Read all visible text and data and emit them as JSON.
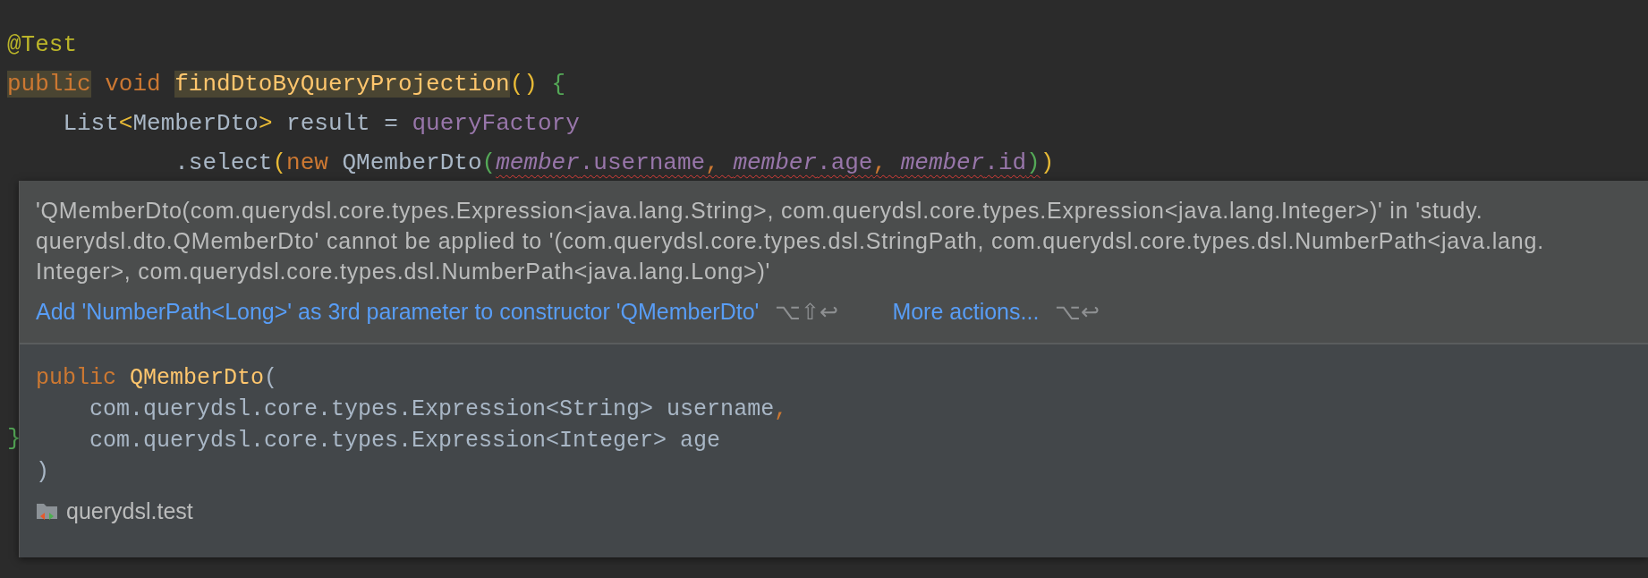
{
  "editor": {
    "lines": [
      [
        {
          "text": "@Test",
          "kind": "annotation"
        }
      ],
      [
        {
          "text": "public",
          "kind": "keyword",
          "highlight": true
        },
        {
          "text": " void ",
          "kind": "keyword"
        },
        {
          "text": "findDtoByQueryProjection",
          "kind": "method",
          "highlight": true
        },
        {
          "text": "()",
          "kind": "paren"
        },
        {
          "text": " {",
          "kind": "nested"
        }
      ],
      [
        {
          "text": "    List",
          "kind": "text"
        },
        {
          "text": "<",
          "kind": "paren"
        },
        {
          "text": "MemberDto",
          "kind": "text"
        },
        {
          "text": ">",
          "kind": "paren"
        },
        {
          "text": " result = ",
          "kind": "text"
        },
        {
          "text": "queryFactory",
          "kind": "field"
        }
      ],
      [
        {
          "text": "            .select",
          "kind": "text"
        },
        {
          "text": "(",
          "kind": "paren"
        },
        {
          "text": "new",
          "kind": "keyword"
        },
        {
          "text": " QMemberDto",
          "kind": "text"
        },
        {
          "text": "(",
          "kind": "nested"
        },
        {
          "text": "member",
          "kind": "static",
          "error": true
        },
        {
          "text": ".username",
          "kind": "field",
          "error": true
        },
        {
          "text": ", ",
          "kind": "comma",
          "error": true
        },
        {
          "text": "member",
          "kind": "static",
          "error": true
        },
        {
          "text": ".age",
          "kind": "field",
          "error": true
        },
        {
          "text": ", ",
          "kind": "comma",
          "error": true
        },
        {
          "text": "member",
          "kind": "static",
          "error": true
        },
        {
          "text": ".id",
          "kind": "field",
          "error": true
        },
        {
          "text": ")",
          "kind": "nested",
          "error": true
        },
        {
          "text": ")",
          "kind": "paren"
        }
      ]
    ],
    "closing": [
      {
        "text": "}",
        "kind": "nested"
      }
    ]
  },
  "popup": {
    "message_lines": [
      "'QMemberDto(com.querydsl.core.types.Expression<java.lang.String>, com.querydsl.core.types.Expression<java.lang.Integer>)' in 'study.",
      "querydsl.dto.QMemberDto' cannot be applied to '(com.querydsl.core.types.dsl.StringPath, com.querydsl.core.types.dsl.NumberPath<java.lang.",
      "Integer>, com.querydsl.core.types.dsl.NumberPath<java.lang.Long>)'"
    ],
    "actions": [
      {
        "label": "Add 'NumberPath<Long>' as 3rd parameter to constructor 'QMemberDto'",
        "shortcut": "⌥⇧↩"
      },
      {
        "label": "More actions...",
        "shortcut": "⌥↩"
      }
    ],
    "declaration": [
      [
        {
          "text": "public",
          "kind": "keyword"
        },
        {
          "text": " QMemberDto",
          "kind": "method"
        },
        {
          "text": "(",
          "kind": "text"
        }
      ],
      [
        {
          "text": "    com.querydsl.core.types.Expression<String> username",
          "kind": "text"
        },
        {
          "text": ",",
          "kind": "comma"
        }
      ],
      [
        {
          "text": "    com.querydsl.core.types.Expression<Integer> age",
          "kind": "text"
        }
      ],
      [
        {
          "text": ")",
          "kind": "text"
        }
      ]
    ],
    "module": "querydsl.test"
  }
}
